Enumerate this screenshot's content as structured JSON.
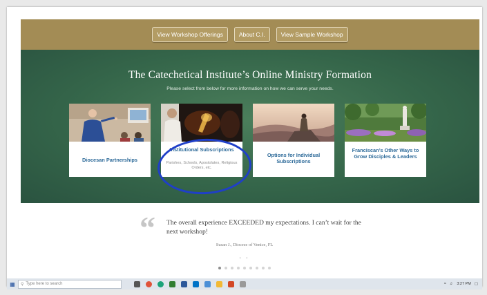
{
  "nav": {
    "workshop_offerings": "View Workshop Offerings",
    "about": "About C.I.",
    "sample_workshop": "View Sample Workshop"
  },
  "hero": {
    "title": "The Catechetical Institute’s Online Ministry Formation",
    "subtitle": "Please select from below for more information on how we can serve your needs."
  },
  "cards": [
    {
      "title": "Diocesan Partnerships",
      "note": ""
    },
    {
      "title": "Institutional Subscriptions",
      "note": "Parishes, Schools, Apostolates, Religious Orders, etc."
    },
    {
      "title": "Options for Individual Subscriptions",
      "note": ""
    },
    {
      "title": "Franciscan’s Other Ways to Grow Disciples & Leaders",
      "note": ""
    }
  ],
  "testimonial": {
    "quote": "The overall experience EXCEEDED my expectations. I can’t wait for the next workshop!",
    "author": "Susan J., Diocese of Venice, FL"
  },
  "carousel": {
    "arrows": "‹ ›",
    "count": 9,
    "active": 0
  },
  "taskbar": {
    "search_placeholder": "Type here to search",
    "time": "3:27 PM"
  },
  "colors": {
    "topbar": "#a38c55",
    "hero_green": "#35664a",
    "card_title": "#2d6a99",
    "annotation_ring": "#1f3fc8"
  }
}
